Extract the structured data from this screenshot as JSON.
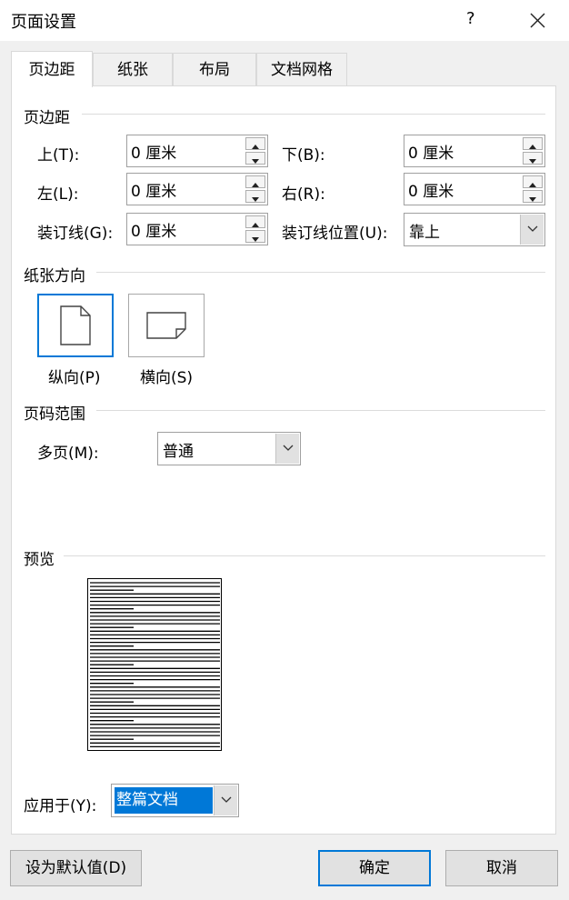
{
  "window": {
    "title": "页面设置",
    "help": "?",
    "close": "×"
  },
  "tabs": [
    {
      "label": "页边距",
      "active": true
    },
    {
      "label": "纸张",
      "active": false
    },
    {
      "label": "布局",
      "active": false
    },
    {
      "label": "文档网格",
      "active": false
    }
  ],
  "margins": {
    "section": "页边距",
    "top": {
      "label": "上(T):",
      "value": "0 厘米"
    },
    "bottom": {
      "label": "下(B):",
      "value": "0 厘米"
    },
    "left": {
      "label": "左(L):",
      "value": "0 厘米"
    },
    "right": {
      "label": "右(R):",
      "value": "0 厘米"
    },
    "gutter": {
      "label": "装订线(G):",
      "value": "0 厘米"
    },
    "gutter_pos": {
      "label": "装订线位置(U):",
      "value": "靠上"
    }
  },
  "orientation": {
    "section": "纸张方向",
    "portrait": {
      "label": "纵向(P)",
      "selected": true
    },
    "landscape": {
      "label": "横向(S)",
      "selected": false
    }
  },
  "pages": {
    "section": "页码范围",
    "multiple": {
      "label": "多页(M):",
      "value": "普通"
    }
  },
  "preview": {
    "section": "预览"
  },
  "apply": {
    "label": "应用于(Y):",
    "value": "整篇文档"
  },
  "buttons": {
    "default": "设为默认值(D)",
    "ok": "确定",
    "cancel": "取消"
  },
  "colors": {
    "accent": "#0078d7",
    "dialog_bg": "#f0f0f0",
    "panel_bg": "#ffffff"
  }
}
